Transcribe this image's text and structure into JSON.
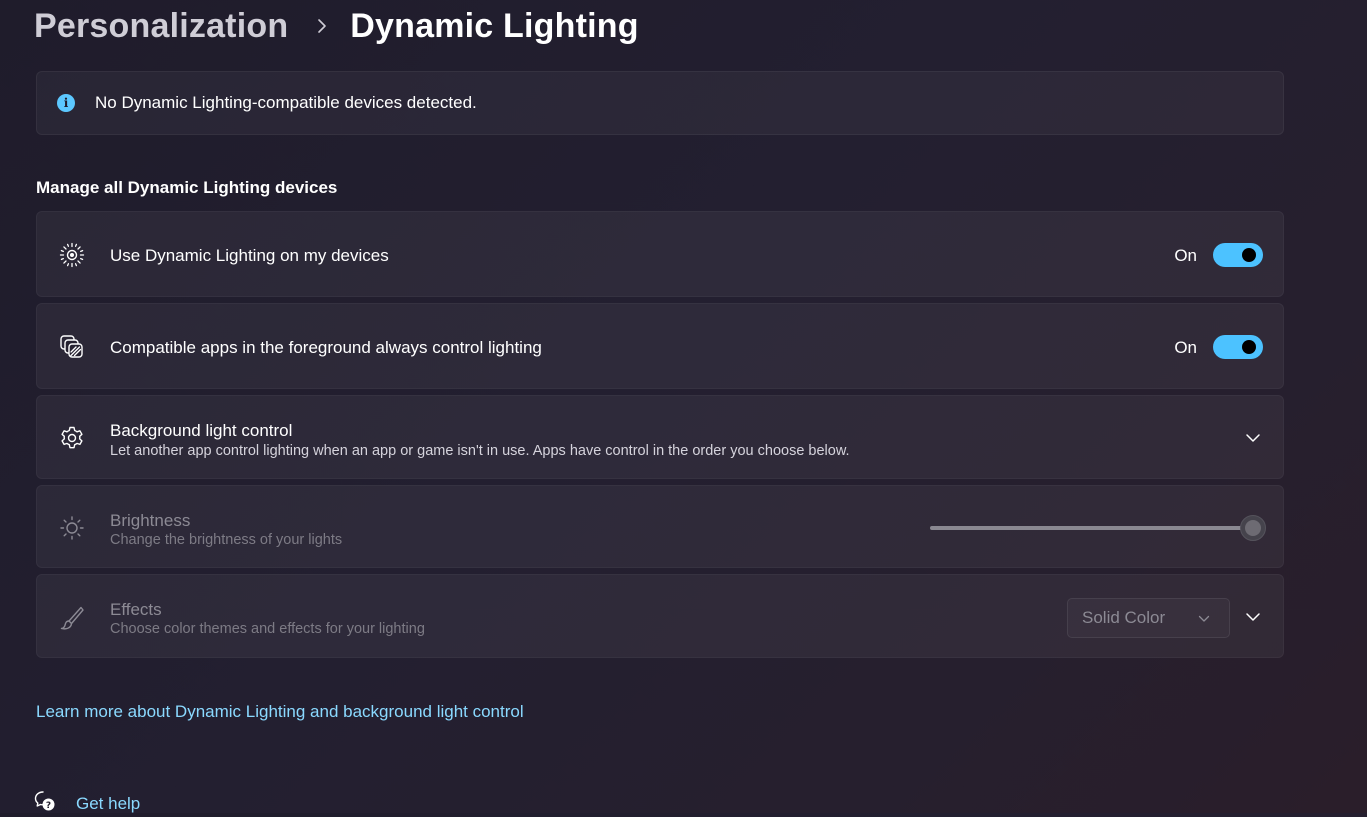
{
  "breadcrumb": {
    "parent": "Personalization",
    "current": "Dynamic Lighting"
  },
  "info_bar": {
    "message": "No Dynamic Lighting-compatible devices detected."
  },
  "section": {
    "title": "Manage all Dynamic Lighting devices"
  },
  "settings": {
    "use_dynamic_lighting": {
      "title": "Use Dynamic Lighting on my devices",
      "state_label": "On",
      "checked": true
    },
    "compatible_apps": {
      "title": "Compatible apps in the foreground always control lighting",
      "state_label": "On",
      "checked": true
    },
    "background_light_control": {
      "title": "Background light control",
      "subtitle": "Let another app control lighting when an app or game isn't in use. Apps have control in the order you choose below."
    },
    "brightness": {
      "title": "Brightness",
      "subtitle": "Change the brightness of your lights",
      "value_fraction": 1.0,
      "enabled": false
    },
    "effects": {
      "title": "Effects",
      "subtitle": "Choose color themes and effects for your lighting",
      "selected": "Solid Color",
      "enabled": false
    }
  },
  "links": {
    "learn_more": "Learn more about Dynamic Lighting and background light control",
    "get_help": "Get help"
  },
  "colors": {
    "accent": "#4cc2ff",
    "link": "#8ad9ff",
    "info_icon": "#5cc8ff"
  },
  "icons": {
    "breadcrumb_separator": "chevron-right-icon",
    "info": "info-icon",
    "use_dynamic_lighting": "dynamic-lighting-icon",
    "compatible_apps": "layered-apps-icon",
    "background_light_control": "gear-icon",
    "brightness": "sun-icon",
    "effects": "paintbrush-icon",
    "get_help": "help-chat-icon"
  }
}
